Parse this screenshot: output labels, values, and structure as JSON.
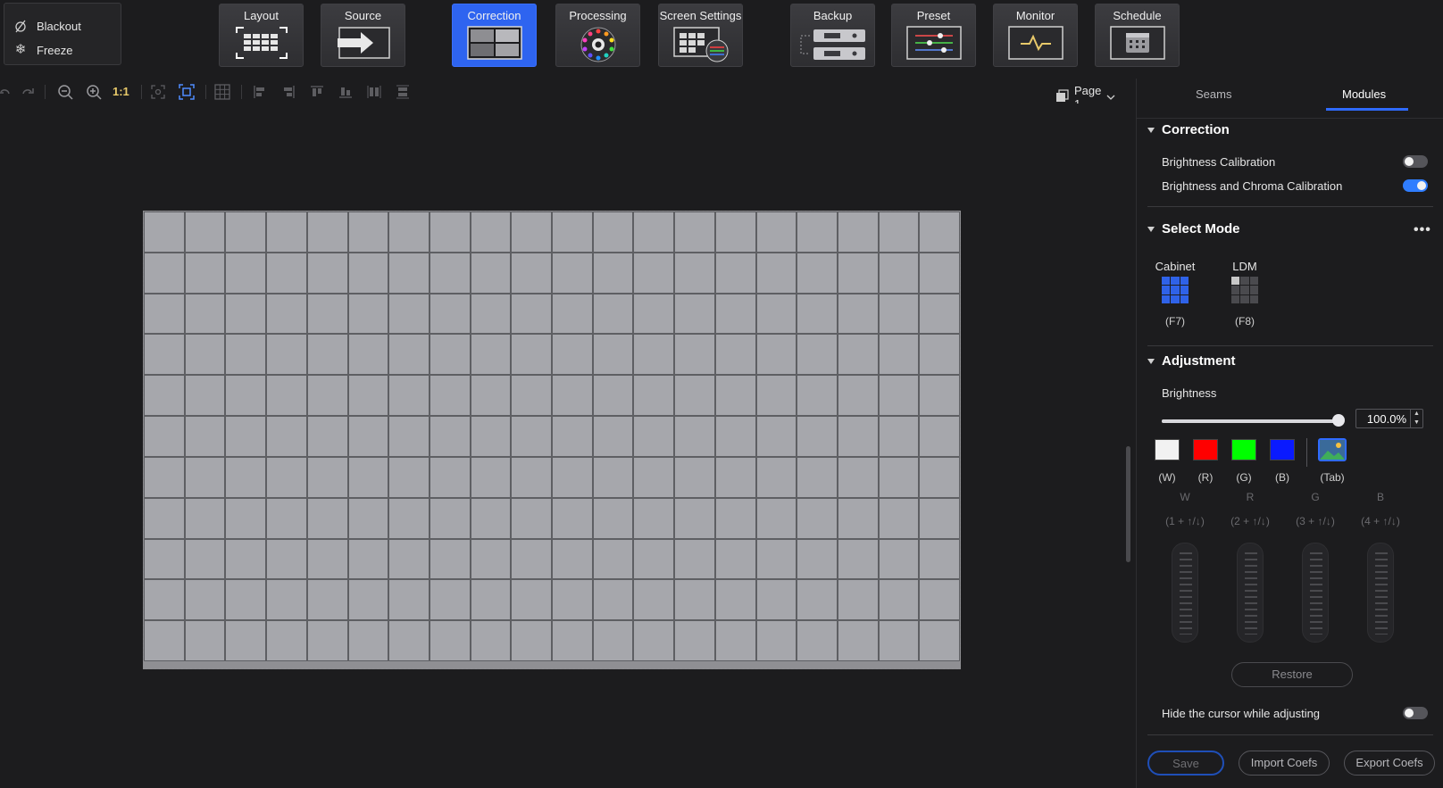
{
  "quick": {
    "blackout": "Blackout",
    "freeze": "Freeze"
  },
  "nav": {
    "layout": "Layout",
    "source": "Source",
    "correction": "Correction",
    "processing": "Processing",
    "screen_settings": "Screen Settings",
    "backup": "Backup",
    "preset": "Preset",
    "monitor": "Monitor",
    "schedule": "Schedule"
  },
  "toolbar": {
    "ratio": "1:1",
    "page": "Page 1"
  },
  "canvas": {
    "columns": 20,
    "rows": 11
  },
  "panel": {
    "tabs": {
      "seams": "Seams",
      "modules": "Modules"
    },
    "correction": {
      "title": "Correction",
      "brightness_calibration": "Brightness Calibration",
      "brightness_calibration_on": false,
      "brightness_chroma": "Brightness and Chroma Calibration",
      "brightness_chroma_on": true
    },
    "select_mode": {
      "title": "Select Mode",
      "more": "•••",
      "cabinet": "Cabinet",
      "cabinet_key": "(F7)",
      "ldm": "LDM",
      "ldm_key": "(F8)"
    },
    "adjustment": {
      "title": "Adjustment",
      "brightness_label": "Brightness",
      "brightness_value": "100.0%",
      "brightness_fraction": 1.0,
      "swatches": [
        {
          "key": "(W)",
          "color": "#f2f2f2"
        },
        {
          "key": "(R)",
          "color": "#ff0000"
        },
        {
          "key": "(G)",
          "color": "#00ff00"
        },
        {
          "key": "(B)",
          "color": "#0a1aff"
        }
      ],
      "tab_key": "(Tab)",
      "channels": [
        {
          "label": "W",
          "key": "(1 + ↑/↓)"
        },
        {
          "label": "R",
          "key": "(2 + ↑/↓)"
        },
        {
          "label": "G",
          "key": "(3 + ↑/↓)"
        },
        {
          "label": "B",
          "key": "(4 + ↑/↓)"
        }
      ],
      "restore": "Restore",
      "hide_cursor": "Hide the cursor while adjusting",
      "hide_cursor_on": false
    },
    "footer": {
      "save": "Save",
      "import": "Import Coefs",
      "export": "Export Coefs"
    }
  }
}
